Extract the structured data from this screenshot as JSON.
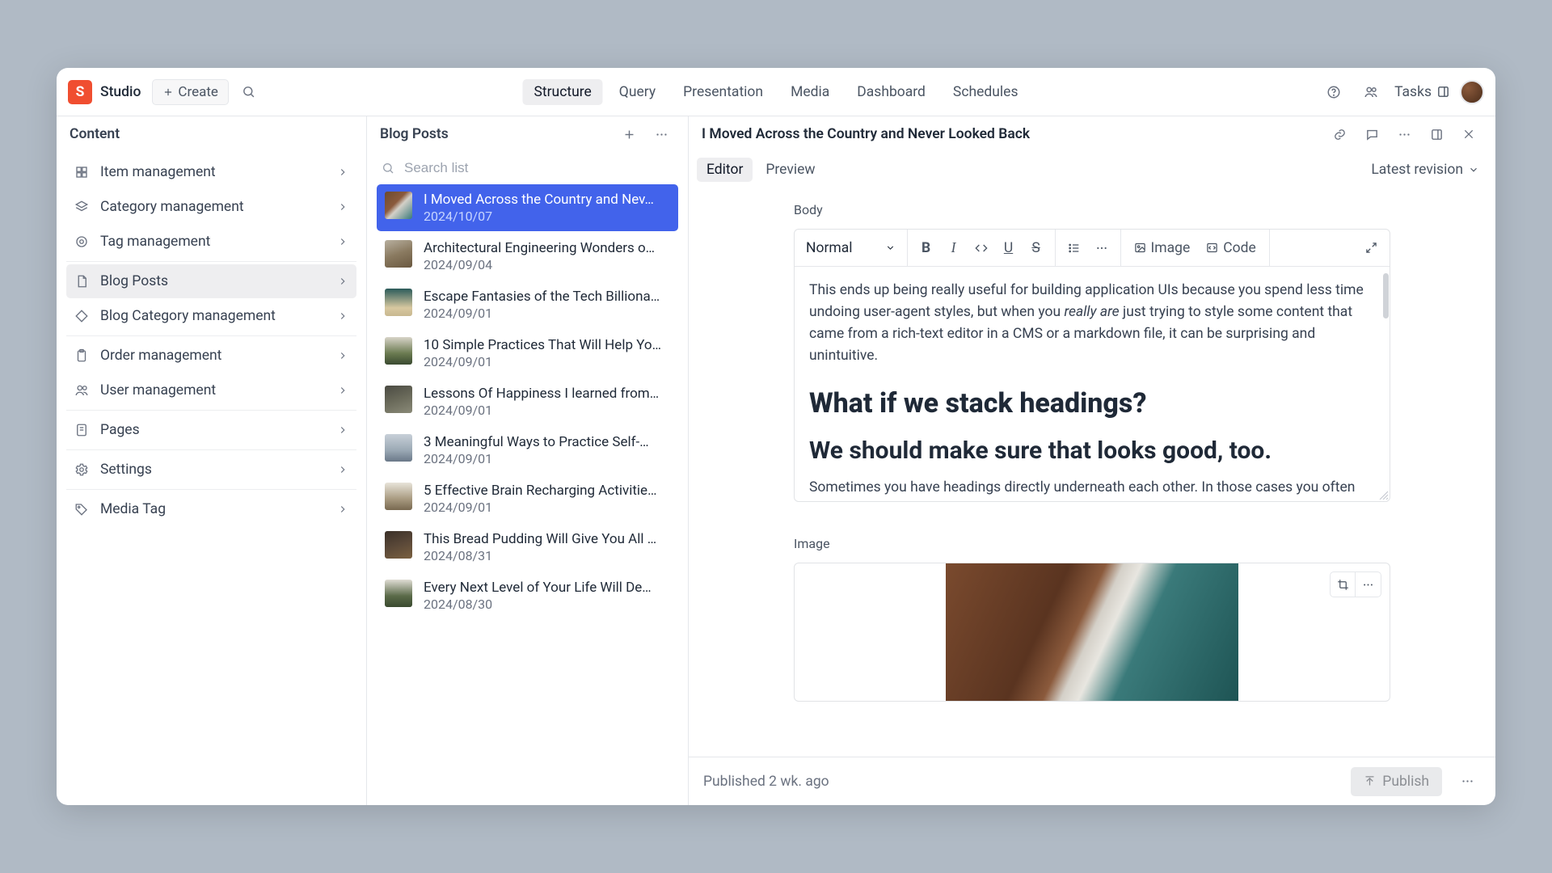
{
  "app": {
    "name": "Studio",
    "logo_letter": "S",
    "create_label": "Create"
  },
  "top_tabs": [
    {
      "label": "Structure",
      "active": true
    },
    {
      "label": "Query"
    },
    {
      "label": "Presentation"
    },
    {
      "label": "Media"
    },
    {
      "label": "Dashboard"
    },
    {
      "label": "Schedules"
    }
  ],
  "top_right": {
    "tasks_label": "Tasks"
  },
  "sidebar": {
    "title": "Content",
    "items": [
      {
        "icon": "grid",
        "label": "Item management"
      },
      {
        "icon": "layers",
        "label": "Category management"
      },
      {
        "icon": "tag",
        "label": "Tag management"
      },
      {
        "sep": true
      },
      {
        "icon": "doc",
        "label": "Blog Posts",
        "active": true
      },
      {
        "icon": "diamond",
        "label": "Blog Category management"
      },
      {
        "sep": true
      },
      {
        "icon": "clipboard",
        "label": "Order management"
      },
      {
        "icon": "users",
        "label": "User management"
      },
      {
        "sep": true
      },
      {
        "icon": "page",
        "label": "Pages"
      },
      {
        "sep": true
      },
      {
        "icon": "gear",
        "label": "Settings"
      },
      {
        "sep": true
      },
      {
        "icon": "label",
        "label": "Media Tag"
      }
    ]
  },
  "list": {
    "title": "Blog Posts",
    "search_placeholder": "Search list",
    "items": [
      {
        "title": "I Moved Across the Country and Nev…",
        "date": "2024/10/07",
        "selected": true,
        "thumb": "coast"
      },
      {
        "title": "Architectural Engineering Wonders o…",
        "date": "2024/09/04",
        "thumb": "arch"
      },
      {
        "title": "Escape Fantasies of the Tech Billiona…",
        "date": "2024/09/01",
        "thumb": "beach"
      },
      {
        "title": "10 Simple Practices That Will Help Yo…",
        "date": "2024/09/01",
        "thumb": "forest"
      },
      {
        "title": "Lessons Of Happiness I learned from…",
        "date": "2024/09/01",
        "thumb": "rock"
      },
      {
        "title": "3 Meaningful Ways to Practice Self-…",
        "date": "2024/09/01",
        "thumb": "eiffel"
      },
      {
        "title": "5 Effective Brain Recharging Activitie…",
        "date": "2024/09/01",
        "thumb": "mountain"
      },
      {
        "title": "This Bread Pudding Will Give You All …",
        "date": "2024/08/31",
        "thumb": "bread"
      },
      {
        "title": "Every Next Level of Your Life Will De…",
        "date": "2024/08/30",
        "thumb": "trees"
      }
    ]
  },
  "editor": {
    "title": "I Moved Across the Country and Never Looked Back",
    "subtabs": [
      {
        "label": "Editor",
        "active": true
      },
      {
        "label": "Preview"
      }
    ],
    "revision_label": "Latest revision",
    "body_label": "Body",
    "image_label": "Image",
    "style_selector": "Normal",
    "insert_image_label": "Image",
    "insert_code_label": "Code",
    "content": {
      "p1_a": "This ends up being really useful for building application UIs because you spend less time undoing user-agent styles, but when you ",
      "p1_em": "really are",
      "p1_b": " just trying to style some content that came from a rich-text editor in a CMS or a markdown file, it can be surprising and unintuitive.",
      "h2": "What if we stack headings?",
      "h3": "We should make sure that looks good, too.",
      "p2": "Sometimes you have headings directly underneath each other. In those cases you often have to undo the top margin on the second heading because it"
    },
    "footer_status": "Published 2 wk. ago",
    "publish_label": "Publish"
  },
  "thumbs": {
    "coast": "linear-gradient(135deg,#6b4a2e 0%,#8b5a3c 40%,#d4d0c8 55%,#3a7a7a 100%)",
    "arch": "linear-gradient(160deg,#b8b0a0 0%,#8a7a60 50%,#6a5840 100%)",
    "beach": "linear-gradient(180deg,#2a5a5a 0%,#d8c8a0 70%,#c8b890 100%)",
    "forest": "linear-gradient(180deg,#d8d4c8 0%,#6a7a50 60%,#3a4a30 100%)",
    "rock": "linear-gradient(160deg,#4a4a42 0%,#6a6a5a 50%,#8a8a78 100%)",
    "eiffel": "linear-gradient(180deg,#c8d0d8 0%,#9aa8b4 60%,#6a7888 100%)",
    "mountain": "linear-gradient(180deg,#e8e4da 0%,#a89a80 60%,#786850 100%)",
    "bread": "linear-gradient(160deg,#3a3028 0%,#5a4838 50%,#7a6040 100%)",
    "trees": "linear-gradient(180deg,#e0ddd4 0%,#5a6a48 60%,#3a4a30 100%)"
  }
}
